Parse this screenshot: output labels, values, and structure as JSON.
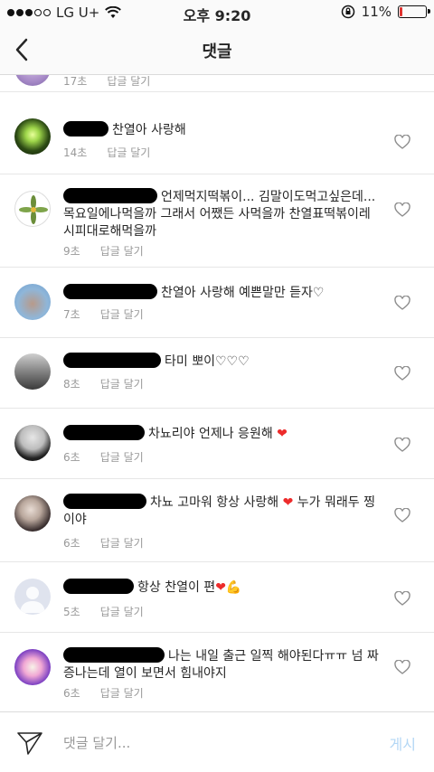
{
  "status_bar": {
    "carrier": "LG U+",
    "time": "오후 9:20",
    "battery": "11%",
    "battery_level": 0.11
  },
  "header": {
    "title": "댓글"
  },
  "comments": [
    {
      "text": "",
      "time": "17초",
      "reply": "답글 달기"
    },
    {
      "text": "찬열아 사랑해",
      "time": "14초",
      "reply": "답글 달기"
    },
    {
      "text": "언제먹지떡볶이... 김말이도먹고싶은데...목요일에나먹을까 그래서 어쨌든 사먹을까 찬열표떡볶이레시피대로해먹을까",
      "time": "9초",
      "reply": "답글 달기"
    },
    {
      "text": "찬열아 사랑해 예쁜말만 듣자♡",
      "time": "7초",
      "reply": "답글 달기"
    },
    {
      "text": "타미 뽀이♡♡♡",
      "time": "8초",
      "reply": "답글 달기"
    },
    {
      "text": "차뇨리야 언제나 응원해",
      "time": "6초",
      "reply": "답글 달기"
    },
    {
      "text": "차뇨 고마워 항상 사랑해",
      "text2": "누가 뭐래두 찡이야",
      "time": "6초",
      "reply": "답글 달기"
    },
    {
      "text": "항상 찬열이 편",
      "time": "5초",
      "reply": "답글 달기"
    },
    {
      "text": "나는 내일 출근 일찍 해야된다ㅠㅠ 넘 짜증나는데 열이 보면서 힘내야지",
      "time": "6초",
      "reply": "답글 달기"
    }
  ],
  "composer": {
    "placeholder": "댓글 달기...",
    "post_label": "게시"
  },
  "colors": {
    "accent_disabled": "#b3d7f5",
    "heart_emoji": "#ed2b2b"
  }
}
